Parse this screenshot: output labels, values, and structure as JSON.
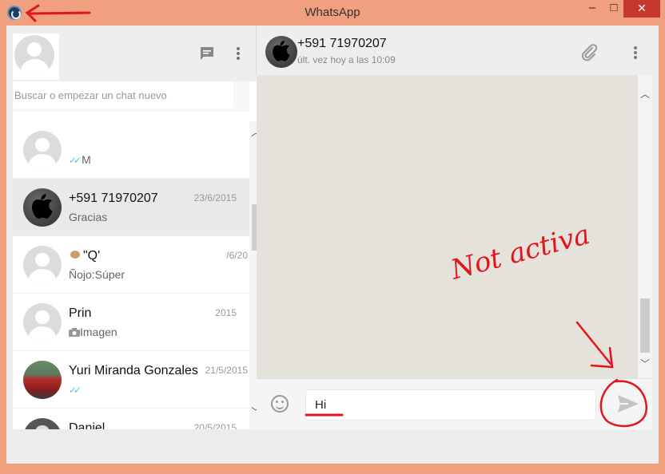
{
  "window": {
    "title": "WhatsApp",
    "min_glyph": "–",
    "max_glyph": "□",
    "close_glyph": "✕"
  },
  "left_header": {
    "new_chat_icon": "chat-icon",
    "menu_icon": "menu-icon"
  },
  "search": {
    "placeholder": "Buscar o empezar un chat nuevo"
  },
  "chats": [
    {
      "name": "",
      "date": "",
      "message": "M",
      "ticks": "✓✓",
      "avatar": "generic"
    },
    {
      "name": "+591 71970207",
      "date": "23/6/2015",
      "message": "Gracias",
      "ticks": "",
      "avatar": "apple"
    },
    {
      "name": "\"Q'",
      "date": "/6/20",
      "message": "Ñojo:Súper",
      "ticks": "",
      "avatar": "generic"
    },
    {
      "name": "Prin",
      "date": "2015",
      "message": "Imagen",
      "ticks": "",
      "avatar": "generic"
    },
    {
      "name": "Yuri Miranda Gonzales",
      "date": "21/5/2015",
      "message": "",
      "ticks": "✓✓",
      "avatar": "car"
    },
    {
      "name": "Daniel",
      "date": "20/5/2015",
      "message": "",
      "ticks": "",
      "avatar": "generic"
    }
  ],
  "conversation": {
    "contact_name": "+591 71970207",
    "last_seen": "últ. vez hoy a las 10:09"
  },
  "composer": {
    "input_value": "Hi",
    "send_icon": "send-icon",
    "emoji_icon": "emoji-icon"
  },
  "annotation": {
    "text": "Not activa",
    "color": "#e3151b"
  },
  "colors": {
    "title_bar": "#f0a07e",
    "close_button": "#c7382c",
    "ticks": "#4fc3f7",
    "chat_background": "#e5e1db"
  }
}
